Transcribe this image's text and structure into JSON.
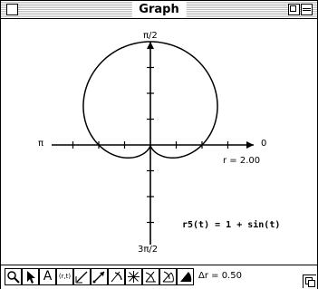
{
  "window": {
    "title": "Graph"
  },
  "graph": {
    "axis_labels": {
      "right": "0",
      "top": "π/2",
      "left": "π",
      "bottom": "3π/2"
    },
    "r_max_label": "r = 2.00",
    "equation": "r5(t) = 1 + sin(t)",
    "curve": {
      "type": "cardioid",
      "formula": "1 + sin(t)",
      "rmax": 2.0
    }
  },
  "toolbar": {
    "tools": [
      {
        "name": "zoom-tool",
        "icon": "magnifier-icon"
      },
      {
        "name": "select-tool",
        "icon": "arrow-pointer-icon"
      },
      {
        "name": "text-tool",
        "icon": "text-a-icon",
        "glyph": "A"
      },
      {
        "name": "coordinate-tool",
        "icon": "coordinate-icon",
        "glyph": "(r,t)"
      },
      {
        "name": "line-tool",
        "icon": "line-icon"
      },
      {
        "name": "ray-tool",
        "icon": "ray-icon"
      },
      {
        "name": "arc-tool",
        "icon": "arc-icon"
      },
      {
        "name": "star-tool",
        "icon": "asterisk-icon"
      },
      {
        "name": "angle-tool",
        "icon": "angle-icon"
      },
      {
        "name": "sector-tool",
        "icon": "sector-icon"
      },
      {
        "name": "fill-tool",
        "icon": "filled-sector-icon"
      }
    ],
    "delta_r": "Δr = 0.50"
  }
}
